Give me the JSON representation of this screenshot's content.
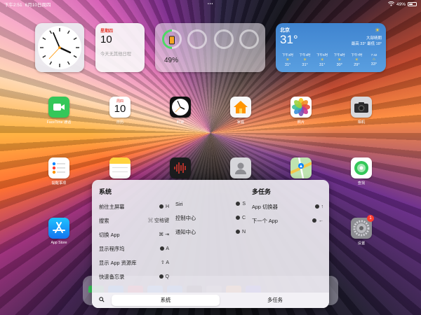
{
  "status_bar": {
    "time": "下午2:51",
    "date": "6月10日周四",
    "battery": "49%"
  },
  "widgets": {
    "calendar": {
      "weekday": "星期四",
      "day": "10",
      "note": "今天无其他日程"
    },
    "battery": {
      "percent": "49%"
    },
    "weather": {
      "city": "北京",
      "temp": "31°",
      "condition": "大部晴朗",
      "range": "最高 33° 最低 18°",
      "forecast": [
        {
          "time": "下午3时",
          "temp": "31°"
        },
        {
          "time": "下午4时",
          "temp": "31°"
        },
        {
          "time": "下午5时",
          "temp": "31°"
        },
        {
          "time": "下午6时",
          "temp": "30°"
        },
        {
          "time": "下午7时",
          "temp": "29°"
        },
        {
          "time": "7:42",
          "temp": "33°"
        }
      ]
    }
  },
  "apps": {
    "facetime": "FaceTime 通话",
    "calendar": "日历",
    "calendar_weekday": "周四",
    "calendar_day": "10",
    "clock": "时钟",
    "home": "家庭",
    "photos": "照片",
    "camera": "相机",
    "reminders": "提醒事项",
    "find": "查找",
    "appstore": "App Store",
    "settings": "设置",
    "settings_badge": "1"
  },
  "shortcuts": {
    "system": {
      "title": "系统",
      "col1": [
        {
          "label": "前往主屏幕",
          "shortcut": "H"
        },
        {
          "label": "搜索",
          "shortcut": "⌘ 空格键"
        },
        {
          "label": "切换 App",
          "shortcut": "⌘ ⇥"
        },
        {
          "label": "显示程序坞",
          "shortcut": "A"
        },
        {
          "label": "显示 App 资源库",
          "shortcut": "⇧ A"
        },
        {
          "label": "快速备忘录",
          "shortcut": "Q"
        }
      ],
      "col2": [
        {
          "label": "Siri",
          "shortcut": "S"
        },
        {
          "label": "控制中心",
          "shortcut": "C"
        },
        {
          "label": "通知中心",
          "shortcut": "N"
        }
      ]
    },
    "multitask": {
      "title": "多任务",
      "items": [
        {
          "label": "App 切换器",
          "shortcut": "↑"
        },
        {
          "label": "下一个 App",
          "shortcut": "←"
        }
      ]
    }
  },
  "tabs": {
    "system": "系统",
    "multitask": "多任务"
  },
  "colors": {
    "accent_red": "#e5382c",
    "battery_green": "#4cd964",
    "weather_blue": "#3f84d0"
  }
}
